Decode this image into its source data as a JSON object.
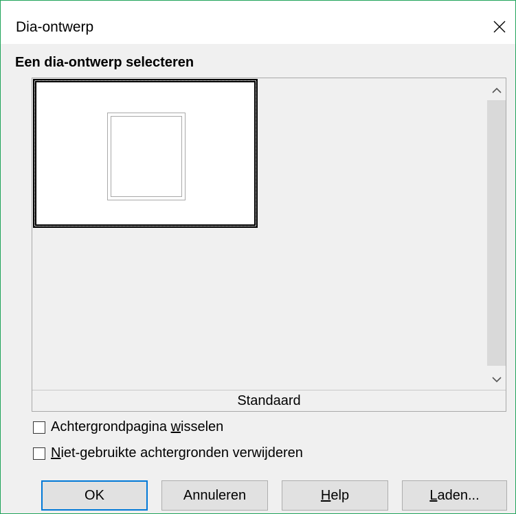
{
  "window": {
    "title": "Dia-ontwerp",
    "close_icon": "close-icon"
  },
  "designs": {
    "label": "Een dia-ontwerp selecteren",
    "items": [
      {
        "caption": "Standaard",
        "selected": true
      }
    ],
    "scroll_up_icon": "chevron-up-icon",
    "scroll_down_icon": "chevron-down-icon"
  },
  "options": {
    "swap_background": {
      "label_pre": "Achtergrondpagina ",
      "label_mnemonic": "w",
      "label_post": "isselen",
      "checked": false
    },
    "delete_unused": {
      "label_pre": "",
      "label_mnemonic": "N",
      "label_post": "iet-gebruikte achtergronden verwijderen",
      "checked": false
    }
  },
  "buttons": {
    "ok": {
      "label": "OK"
    },
    "cancel": {
      "label": "Annuleren"
    },
    "help": {
      "label_mnemonic": "H",
      "label_post": "elp"
    },
    "load": {
      "label_mnemonic": "L",
      "label_post": "aden..."
    }
  },
  "colors": {
    "window_border": "#1fa35a",
    "default_button_border": "#0078d7"
  }
}
